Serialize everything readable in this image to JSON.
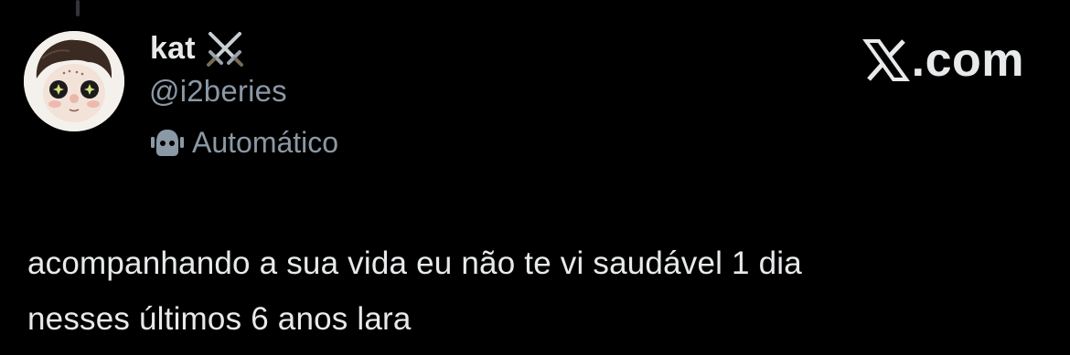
{
  "author": {
    "display_name": "kat",
    "badge_icon": "crossed-swords-icon",
    "handle": "@i2beries",
    "automated_label": "Automático",
    "automated_icon": "bot-icon"
  },
  "brand": {
    "logo_icon": "x-logo-icon",
    "text": ".com"
  },
  "tweet": {
    "lines": [
      "acompanhando a sua vida eu não te vi saudável 1 dia",
      "nesses últimos 6 anos lara"
    ]
  },
  "colors": {
    "background": "#000000",
    "primary_text": "#e7e9ea",
    "secondary_text": "#8b98a5"
  }
}
